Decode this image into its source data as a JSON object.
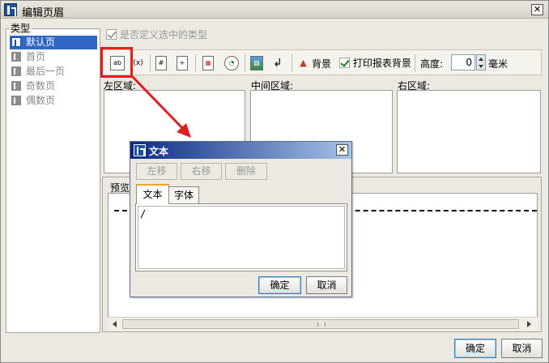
{
  "window": {
    "title": "编辑页眉",
    "close_label": "✕"
  },
  "type_panel": {
    "label": "类型",
    "items": [
      {
        "label": "默认页",
        "selected": true
      },
      {
        "label": "首页",
        "selected": false
      },
      {
        "label": "最后一页",
        "selected": false
      },
      {
        "label": "奇数页",
        "selected": false
      },
      {
        "label": "偶数页",
        "selected": false
      }
    ]
  },
  "custom_type_checkbox": {
    "label": "是否定义选中的类型",
    "checked": true,
    "enabled": false
  },
  "toolbar": {
    "text_btn": "ab",
    "formula_btn": "f(x)",
    "page_number_btn": "#",
    "total_pages_btn": "+",
    "date_btn": "▦",
    "time_btn": "◔",
    "image_btn": "▨",
    "newline_btn": "↲",
    "background_label": "背景",
    "print_bg_label": "打印报表背景",
    "print_bg_checked": true,
    "height_label": "高度:",
    "height_value": "0",
    "unit_label": "毫米"
  },
  "regions": {
    "left": "左区域:",
    "center": "中间区域:",
    "right": "右区域:"
  },
  "preview": {
    "label": "预览"
  },
  "buttons": {
    "ok": "确定",
    "cancel": "取消"
  },
  "text_dialog": {
    "title": "文本",
    "close_label": "✕",
    "move_left": "左移",
    "move_right": "右移",
    "delete": "删除",
    "tabs": [
      "文本",
      "字体"
    ],
    "active_tab": "文本",
    "text_value": "/",
    "ok": "确定",
    "cancel": "取消"
  },
  "colors": {
    "highlight": "#e02020",
    "selection": "#3166c4",
    "dialog_title": "#0b2a84"
  }
}
